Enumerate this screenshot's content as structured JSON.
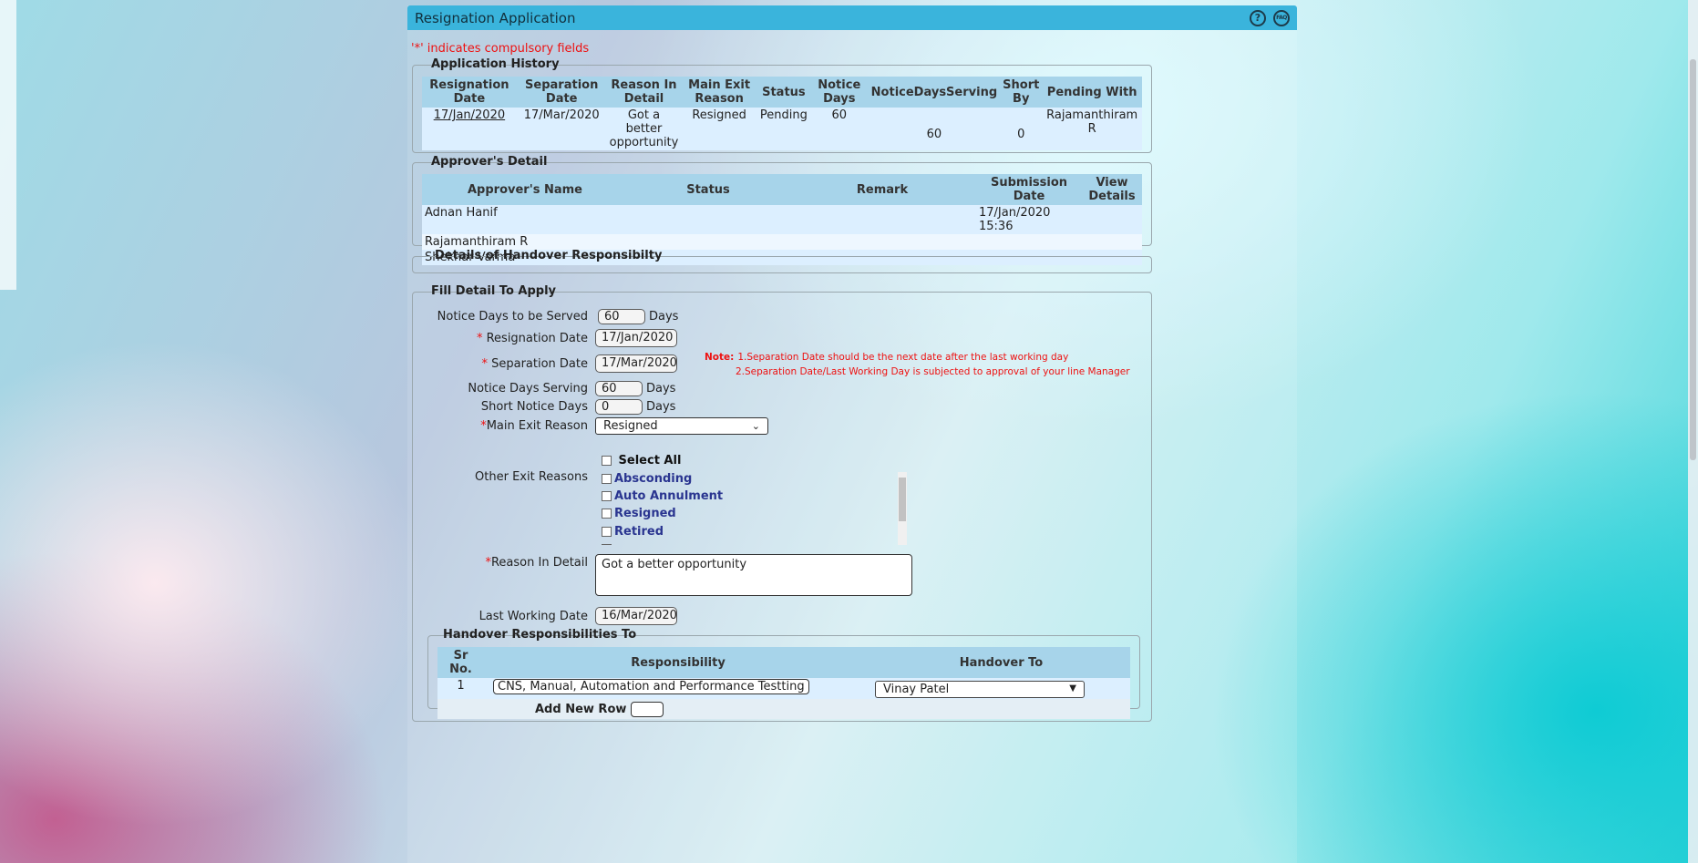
{
  "window": {
    "title": "Resignation Application"
  },
  "required_note": "'*' indicates compulsory fields",
  "history": {
    "legend": "Application History",
    "headers": [
      "Resignation Date",
      "Separation Date",
      "Reason In Detail",
      "Main Exit Reason",
      "Status",
      "Notice Days",
      "NoticeDaysServing",
      "Short By",
      "Pending With"
    ],
    "row": {
      "resignation_date": "17/Jan/2020",
      "separation_date": "17/Mar/2020",
      "reason": "Got a better opportunity",
      "main_exit_reason": "Resigned",
      "status": "Pending",
      "notice_days": "60",
      "notice_days_serving": "60",
      "short_by": "0",
      "pending_with": "Rajamanthiram R"
    }
  },
  "approvers": {
    "legend": "Approver's Detail",
    "headers": [
      "Approver's Name",
      "Status",
      "Remark",
      "Submission Date",
      "View Details"
    ],
    "rows": [
      {
        "name": "Adnan Hanif",
        "status": "",
        "remark": "",
        "submission_date": "17/Jan/2020 15:36",
        "view": ""
      },
      {
        "name": "Rajamanthiram R",
        "status": "",
        "remark": "",
        "submission_date": "",
        "view": ""
      },
      {
        "name": "Shekhar Varma",
        "status": "",
        "remark": "",
        "submission_date": "",
        "view": ""
      }
    ]
  },
  "handover_details": {
    "legend": "Details of Handover Responsibilty"
  },
  "form": {
    "legend": "Fill Detail To Apply",
    "notice_days_label": "Notice Days to be Served",
    "notice_days_value": "60",
    "days_unit": "Days",
    "resignation_date_label": "Resignation Date",
    "resignation_date_value": "17/Jan/2020",
    "separation_date_label": "Separation Date",
    "separation_date_value": "17/Mar/2020",
    "note_label": "Note:",
    "note_line1": "1.Separation Date should be the next date after the last working day",
    "note_line2": "2.Separation Date/Last Working Day is subjected to approval of your line Manager",
    "notice_serving_label": "Notice Days Serving",
    "notice_serving_value": "60",
    "short_notice_label": "Short Notice Days",
    "short_notice_value": "0",
    "main_exit_label": "Main Exit Reason",
    "main_exit_value": "Resigned",
    "select_all_label": "Select All",
    "other_exit_label": "Other Exit Reasons",
    "other_exit_options": [
      "Absconding",
      "Auto Annulment",
      "Resigned",
      "Retired"
    ],
    "reason_label": "Reason In Detail",
    "reason_value": "Got a better opportunity",
    "last_working_label": "Last Working Date",
    "last_working_value": "16/Mar/2020"
  },
  "handover_to": {
    "legend": "Handover Responsibilities To",
    "headers": [
      "Sr No.",
      "Responsibility",
      "Handover To"
    ],
    "row": {
      "sr": "1",
      "responsibility": "CNS, Manual, Automation and Performance Testting",
      "handover_to": "Vinay Patel"
    },
    "add_row_label": "Add New Row",
    "add_row_value": ""
  }
}
